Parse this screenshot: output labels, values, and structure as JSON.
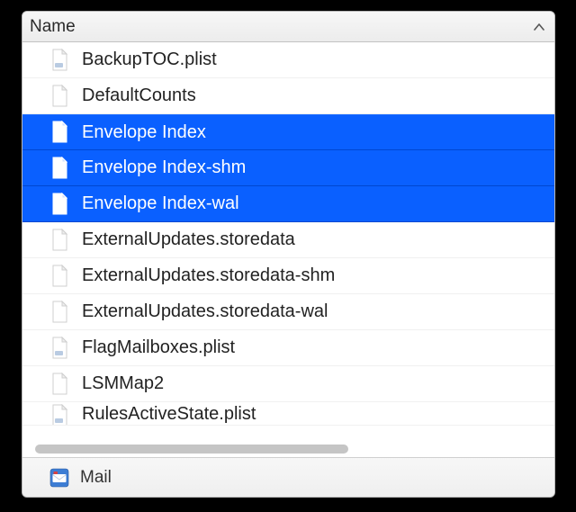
{
  "header": {
    "column_label": "Name",
    "sort_direction": "ascending"
  },
  "files": [
    {
      "name": "BackupTOC.plist",
      "icon": "plist",
      "selected": false
    },
    {
      "name": "DefaultCounts",
      "icon": "blank",
      "selected": false
    },
    {
      "name": "Envelope Index",
      "icon": "blank",
      "selected": true
    },
    {
      "name": "Envelope Index-shm",
      "icon": "blank",
      "selected": true
    },
    {
      "name": "Envelope Index-wal",
      "icon": "blank",
      "selected": true
    },
    {
      "name": "ExternalUpdates.storedata",
      "icon": "blank",
      "selected": false
    },
    {
      "name": "ExternalUpdates.storedata-shm",
      "icon": "blank",
      "selected": false
    },
    {
      "name": "ExternalUpdates.storedata-wal",
      "icon": "blank",
      "selected": false
    },
    {
      "name": "FlagMailboxes.plist",
      "icon": "plist",
      "selected": false
    },
    {
      "name": "LSMMap2",
      "icon": "blank",
      "selected": false
    },
    {
      "name": "RulesActiveState.plist",
      "icon": "plist",
      "selected": false,
      "partial": true
    }
  ],
  "footer": {
    "folder_label": "Mail",
    "folder_icon": "mail-app"
  },
  "colors": {
    "selection": "#0a60ff"
  }
}
